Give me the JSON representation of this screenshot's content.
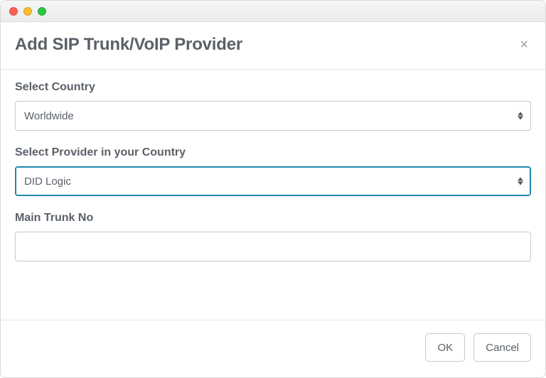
{
  "dialog": {
    "title": "Add SIP Trunk/VoIP Provider",
    "close_label": "×"
  },
  "fields": {
    "country": {
      "label": "Select Country",
      "value": "Worldwide"
    },
    "provider": {
      "label": "Select Provider in your Country",
      "value": "DID Logic"
    },
    "trunkno": {
      "label": "Main Trunk No",
      "value": ""
    }
  },
  "buttons": {
    "ok": "OK",
    "cancel": "Cancel"
  }
}
